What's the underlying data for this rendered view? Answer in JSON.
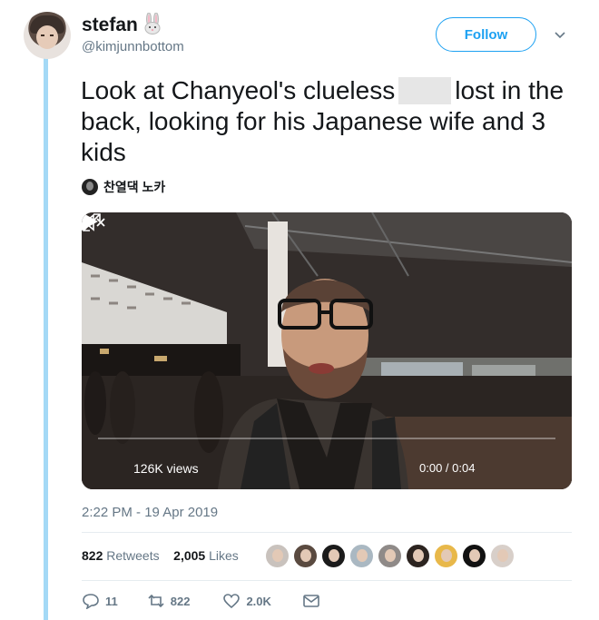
{
  "user": {
    "name": "stefan",
    "handle": "@kimjunnbottom",
    "emoji": "rabbit"
  },
  "follow_label": "Follow",
  "tweet": {
    "text_before": "Look at Chanyeol's clueless",
    "text_after": "lost in the back, looking for his Japanese wife and 3 kids"
  },
  "attribution": {
    "name": "찬열댁 노카"
  },
  "video": {
    "views": "126K views",
    "time": "0:00 / 0:04"
  },
  "timestamp": "2:22 PM - 19 Apr 2019",
  "stats": {
    "retweets_count": "822",
    "retweets_label": "Retweets",
    "likes_count": "2,005",
    "likes_label": "Likes"
  },
  "likers": [
    {
      "color": "#c9c2bd"
    },
    {
      "color": "#5a4a40"
    },
    {
      "color": "#1b1b1b"
    },
    {
      "color": "#aab8c2"
    },
    {
      "color": "#8f8a88"
    },
    {
      "color": "#2c2420"
    },
    {
      "color": "#e8b84a"
    },
    {
      "color": "#111111"
    },
    {
      "color": "#d8cfc9"
    }
  ],
  "actions": {
    "replies": "11",
    "retweets": "822",
    "likes": "2.0K"
  },
  "colors": {
    "accent": "#1da1f2",
    "thread_line": "#a4d9f6",
    "muted": "#657786"
  }
}
